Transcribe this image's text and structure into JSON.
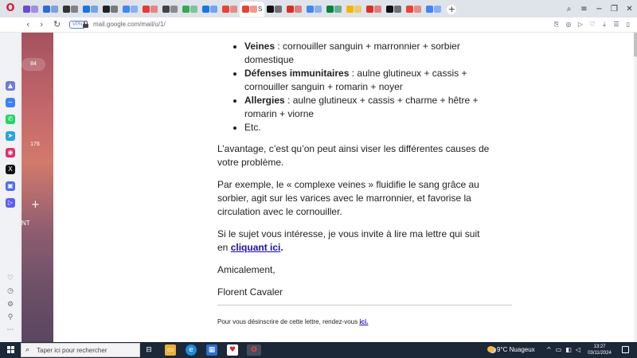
{
  "browser": {
    "tabs": [
      {
        "label": "",
        "color": "#6a4bd6"
      },
      {
        "label": "",
        "color": "#2f6bd0"
      },
      {
        "label": "",
        "color": "#333333"
      },
      {
        "label": "",
        "color": "#1a73e8"
      },
      {
        "label": "",
        "color": "#222222"
      },
      {
        "label": "",
        "color": "#4285f4"
      },
      {
        "label": "",
        "color": "#e53935"
      },
      {
        "label": "",
        "color": "#424242"
      },
      {
        "label": "",
        "color": "#34a853"
      },
      {
        "label": "",
        "color": "#1a73e8"
      },
      {
        "label": "",
        "color": "#ea4335"
      },
      {
        "label": "S",
        "color": "#ea4335"
      },
      {
        "label": "",
        "color": "#111111"
      },
      {
        "label": "",
        "color": "#d93025"
      },
      {
        "label": "",
        "color": "#4285f4"
      },
      {
        "label": "",
        "color": "#0b8043"
      },
      {
        "label": "",
        "color": "#f4b400"
      },
      {
        "label": "",
        "color": "#d93025"
      },
      {
        "label": "",
        "color": "#111111"
      },
      {
        "label": "",
        "color": "#ea4335"
      },
      {
        "label": "",
        "color": "#4285f4"
      }
    ],
    "active_tab_index": 11,
    "url": "mail.google.com/mail/u/1/",
    "vpn_label": "VPN"
  },
  "gmail": {
    "badge_count_1": "84",
    "badge_count_2": "176",
    "side_label": "NT"
  },
  "email": {
    "list": [
      {
        "bold": "Veines",
        "text": " : cornouiller sanguin + marronnier + sorbier domestique"
      },
      {
        "bold": "Défenses immunitaires",
        "text": " : aulne glutineux + cassis + cornouiller sanguin + romarin + noyer"
      },
      {
        "bold": "Allergies",
        "text": " : aulne glutineux + cassis + charme + hêtre + romarin + viorne"
      },
      {
        "bold": "",
        "text": "Etc."
      }
    ],
    "para1": "L’avantage, c’est qu’on peut ainsi viser les différentes causes de votre problème.",
    "para2": "Par exemple, le « complexe veines » fluidifie le sang grâce au sorbier, agit sur les varices avec le marronnier, et favorise la circulation avec le cornouiller.",
    "para3_line1": "Si le sujet vous intéresse, je vous invite à lire ma lettre qui suit",
    "para3_pre": "en ",
    "para3_link": "cliquant ici",
    "para3_post": ".",
    "closing": "Amicalement,",
    "signature": "Florent Cavaler",
    "footer_text": "Pour vous désinscrire de cette lettre, rendez-vous ",
    "footer_link": "ici."
  },
  "taskbar": {
    "search_placeholder": "Taper ici pour rechercher",
    "weather": "9°C  Nuageux",
    "time": "13:27",
    "date": "03/11/2024"
  },
  "icons": {
    "sidebar": [
      "aria-icon",
      "messenger-icon",
      "whatsapp-icon",
      "telegram-icon",
      "instagram-icon",
      "x-icon",
      "player-icon",
      "music-icon"
    ],
    "sidebar_bottom": [
      "heart-icon",
      "history-icon",
      "settings-icon",
      "pin-icon",
      "more-icon"
    ]
  }
}
